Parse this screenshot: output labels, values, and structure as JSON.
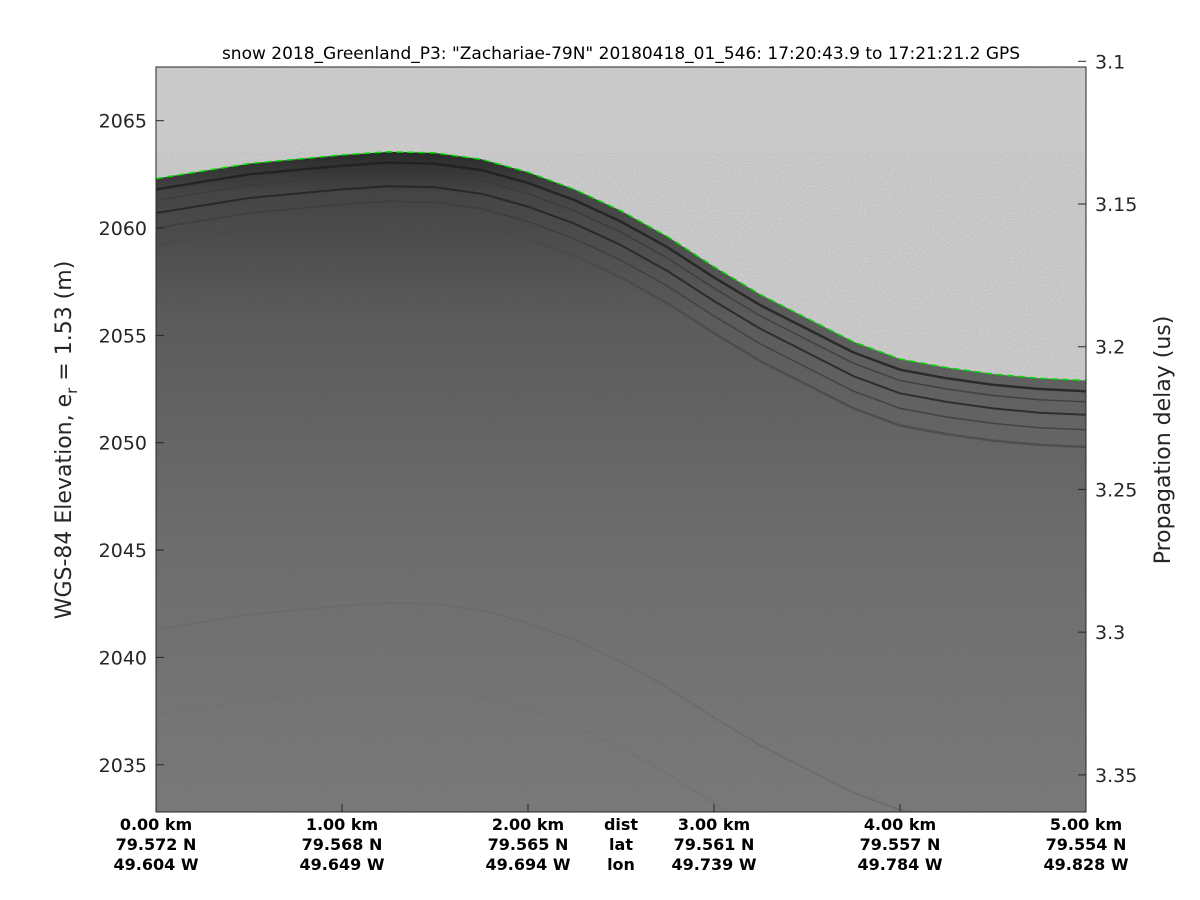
{
  "chart_data": {
    "type": "heatmap",
    "title": "snow 2018_Greenland_P3: \"Zachariae-79N\"  20180418_01_546: 17:20:43.9 to 17:21:21.2 GPS",
    "ylabel_left": "WGS-84 Elevation, e",
    "ylabel_left_sub": "r",
    "ylabel_left_suffix": " = 1.53 (m)",
    "ylabel_right": "Propagation delay (us)",
    "ylim_left": [
      2032.8,
      2067.5
    ],
    "ylim_right": [
      3.102,
      3.363
    ],
    "left_ticks": [
      {
        "value": 2065,
        "label": "2065"
      },
      {
        "value": 2060,
        "label": "2060"
      },
      {
        "value": 2055,
        "label": "2055"
      },
      {
        "value": 2050,
        "label": "2050"
      },
      {
        "value": 2045,
        "label": "2045"
      },
      {
        "value": 2040,
        "label": "2040"
      },
      {
        "value": 2035,
        "label": "2035"
      }
    ],
    "right_ticks": [
      {
        "value": 3.1,
        "label": "3.1"
      },
      {
        "value": 3.15,
        "label": "3.15"
      },
      {
        "value": 3.2,
        "label": "3.2"
      },
      {
        "value": 3.25,
        "label": "3.25"
      },
      {
        "value": 3.3,
        "label": "3.3"
      },
      {
        "value": 3.35,
        "label": "3.35"
      }
    ],
    "x_km_range": [
      0,
      5
    ],
    "x_ticks": [
      {
        "km": 0,
        "dist": "0.00 km",
        "lat": "79.572 N",
        "lon": "49.604 W"
      },
      {
        "km": 1,
        "dist": "1.00 km",
        "lat": "79.568 N",
        "lon": "49.649 W"
      },
      {
        "km": 2,
        "dist": "2.00 km",
        "lat": "79.565 N",
        "lon": "49.694 W"
      },
      {
        "km": 3,
        "dist": "3.00 km",
        "lat": "79.561 N",
        "lon": "49.739 W"
      },
      {
        "km": 4,
        "dist": "4.00 km",
        "lat": "79.557 N",
        "lon": "49.784 W"
      },
      {
        "km": 5,
        "dist": "5.00 km",
        "lat": "79.554 N",
        "lon": "49.828 W"
      }
    ],
    "row_labels": {
      "dist": "dist",
      "lat": "lat",
      "lon": "lon"
    },
    "row_labels_km": 2.5,
    "surface_series": {
      "color": "#00e000",
      "x_km": [
        0,
        0.5,
        1.0,
        1.25,
        1.5,
        1.75,
        2.0,
        2.25,
        2.5,
        2.75,
        3.0,
        3.25,
        3.5,
        3.75,
        4.0,
        4.25,
        4.5,
        4.75,
        5.0
      ],
      "elevation_m": [
        2062.3,
        2063.0,
        2063.4,
        2063.55,
        2063.5,
        2063.2,
        2062.6,
        2061.8,
        2060.8,
        2059.6,
        2058.2,
        2056.9,
        2055.8,
        2054.7,
        2053.9,
        2053.5,
        2053.2,
        2053.0,
        2052.9
      ]
    },
    "colors": {
      "air": "#cfcfcf",
      "snow_top": "#2a2a2a",
      "snow_mid": "#5e5e5e",
      "snow_deep": "#767676",
      "layer_line": "#5a5a5a"
    }
  }
}
